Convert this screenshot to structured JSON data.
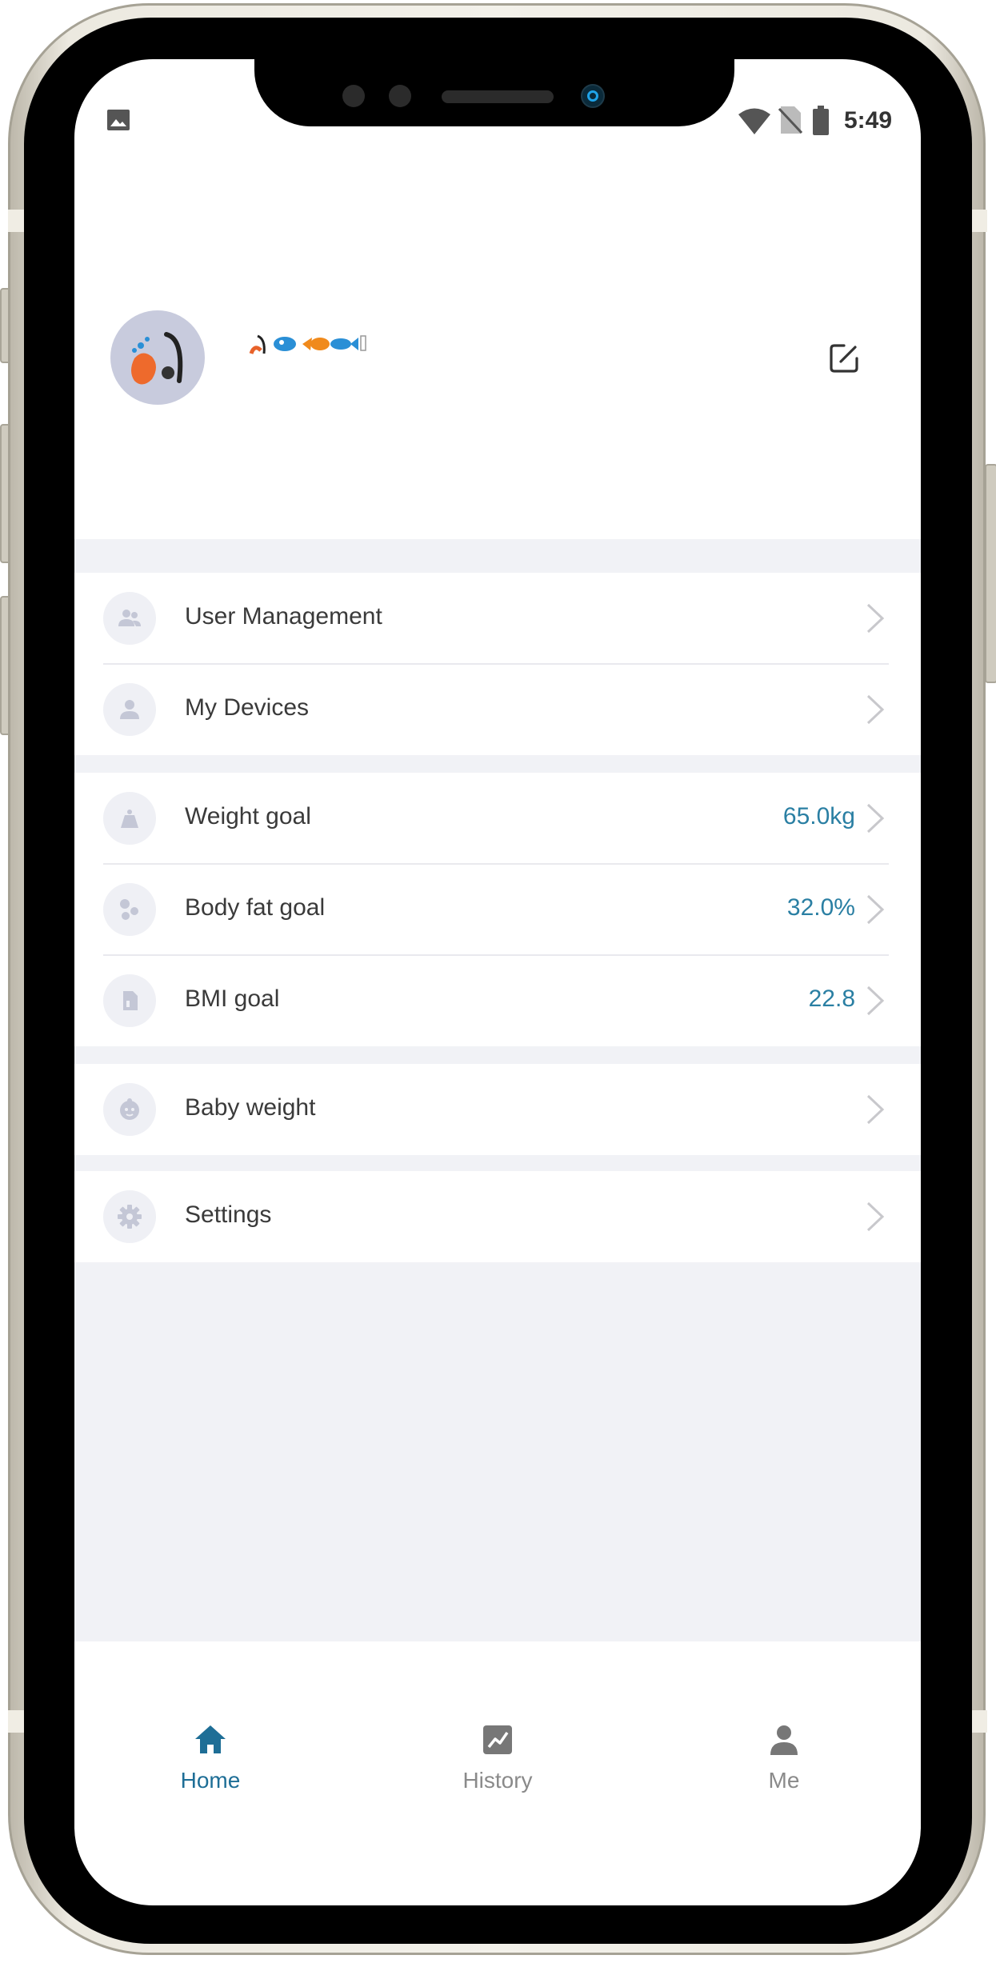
{
  "status_bar": {
    "time": "5:49",
    "icons": [
      "gallery-icon",
      "wifi-icon",
      "no-sim-icon",
      "battery-icon"
    ]
  },
  "profile": {
    "avatar_icon": "fishing-avatar-icon",
    "username_icon": "emoji-fishing-username",
    "edit_icon": "edit-icon"
  },
  "menu": {
    "group1": [
      {
        "label": "User Management",
        "icon": "users-icon"
      },
      {
        "label": "My Devices",
        "icon": "person-icon"
      }
    ],
    "group2": [
      {
        "label": "Weight goal",
        "value": "65.0kg",
        "icon": "weight-icon"
      },
      {
        "label": "Body fat goal",
        "value": "32.0%",
        "icon": "body-fat-icon"
      },
      {
        "label": "BMI goal",
        "value": "22.8",
        "icon": "bmi-icon"
      }
    ],
    "group3": [
      {
        "label": "Baby weight",
        "icon": "baby-icon"
      }
    ],
    "group4": [
      {
        "label": "Settings",
        "icon": "gear-icon"
      }
    ]
  },
  "tabs": [
    {
      "label": "Home",
      "icon": "home-icon",
      "active": true
    },
    {
      "label": "History",
      "icon": "chart-icon",
      "active": false
    },
    {
      "label": "Me",
      "icon": "person-icon",
      "active": false
    }
  ],
  "colors": {
    "accent": "#1e6e96",
    "value_text": "#2a7fa3",
    "inactive_tab": "#8a8a8a",
    "list_background": "#f1f2f6",
    "icon_gray": "#c4c7d6"
  }
}
